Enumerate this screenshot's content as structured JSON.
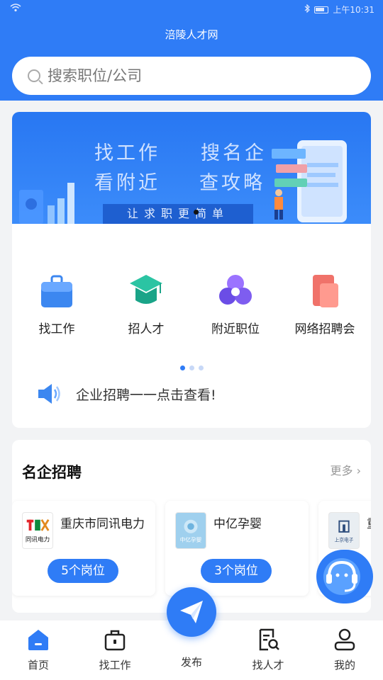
{
  "status_bar": {
    "time": "上午10:31"
  },
  "header": {
    "title": "涪陵人才网"
  },
  "search": {
    "placeholder": "搜索职位/公司"
  },
  "banner": {
    "line1_left": "找工作",
    "line1_right": "搜名企",
    "line2_left": "看附近",
    "line2_right": "查攻略",
    "slogan": "让求职更简单"
  },
  "quick_links": [
    {
      "label": "找工作",
      "icon": "briefcase-icon"
    },
    {
      "label": "招人才",
      "icon": "graduation-cap-icon"
    },
    {
      "label": "附近职位",
      "icon": "location-circles-icon"
    },
    {
      "label": "网络招聘会",
      "icon": "cards-icon"
    }
  ],
  "notice": {
    "text": "企业招聘一一点击查看!"
  },
  "companies_section": {
    "title": "名企招聘",
    "more_label": "更多",
    "companies": [
      {
        "name": "重庆市同讯电力",
        "jobs": "5个岗位",
        "logo_text": "同讯电力"
      },
      {
        "name": "中亿孕婴",
        "jobs": "3个岗位",
        "logo_text": "中亿孕婴"
      },
      {
        "name": "重",
        "jobs": "",
        "logo_text": "上京电子"
      }
    ]
  },
  "tabbar": {
    "items": [
      {
        "label": "首页",
        "icon": "home-icon"
      },
      {
        "label": "找工作",
        "icon": "briefcase-outline-icon"
      },
      {
        "label": "发布",
        "icon": "paper-plane-icon"
      },
      {
        "label": "找人才",
        "icon": "document-search-icon"
      },
      {
        "label": "我的",
        "icon": "user-icon"
      }
    ]
  },
  "colors": {
    "primary": "#2f7cf6",
    "background": "#f2f3f5"
  }
}
